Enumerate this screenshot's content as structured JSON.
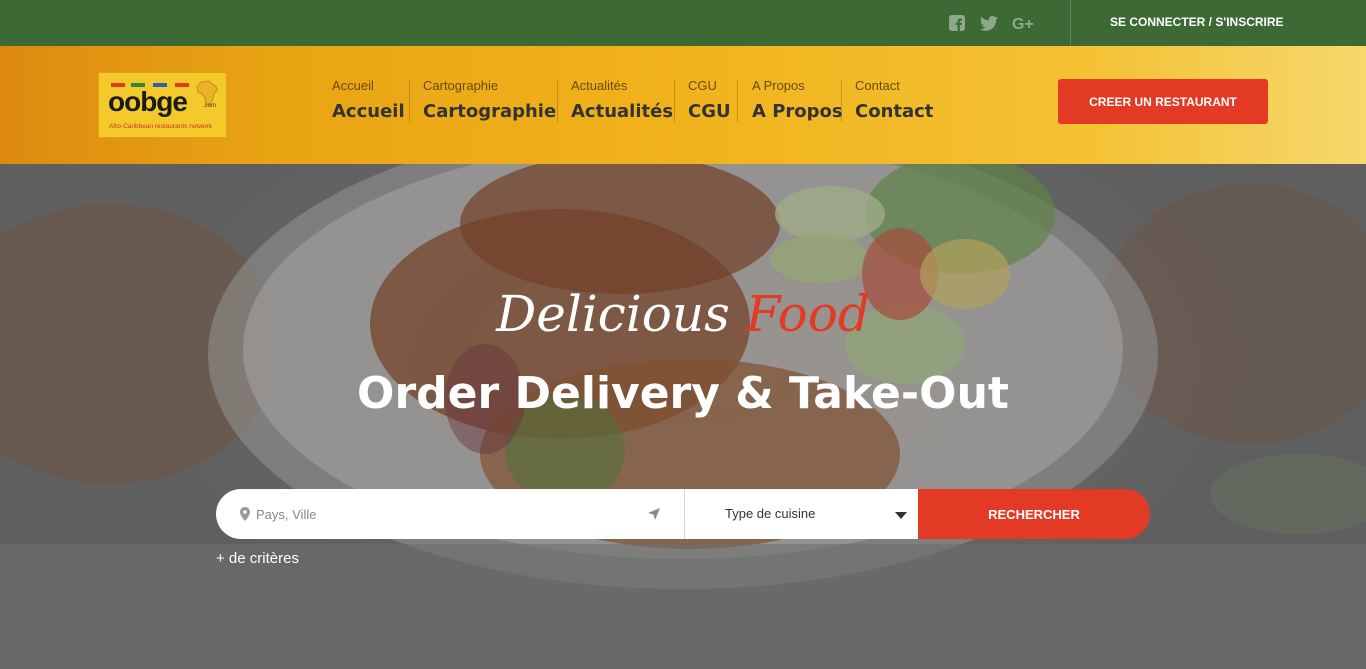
{
  "topbar": {
    "social_icons": [
      "facebook-icon",
      "twitter-icon",
      "google-plus-icon"
    ],
    "login_label": "SE CONNECTER / S'INSCRIRE"
  },
  "header": {
    "logo": {
      "word": "oobge",
      "domain": ".com",
      "tagline": "Afro-Caribbean restaurants network"
    },
    "nav": [
      {
        "small": "Accueil",
        "big": "Accueil"
      },
      {
        "small": "Cartographie",
        "big": "Cartographie"
      },
      {
        "small": "Actualités",
        "big": "Actualités"
      },
      {
        "small": "CGU",
        "big": "CGU"
      },
      {
        "small": "A Propos",
        "big": "A Propos"
      },
      {
        "small": "Contact",
        "big": "Contact"
      }
    ],
    "create_button": "CREER UN RESTAURANT"
  },
  "hero": {
    "script_word1": "Delicious",
    "script_word2": "Food",
    "headline": "Order Delivery & Take-Out",
    "search": {
      "location_placeholder": "Pays, Ville",
      "cuisine_label": "Type de cuisine",
      "button_label": "RECHERCHER"
    },
    "more_criteria": "+ de critères"
  },
  "colors": {
    "topbar": "#3c6934",
    "accent_red": "#e23a25",
    "header_gold": "#f1b31c"
  }
}
